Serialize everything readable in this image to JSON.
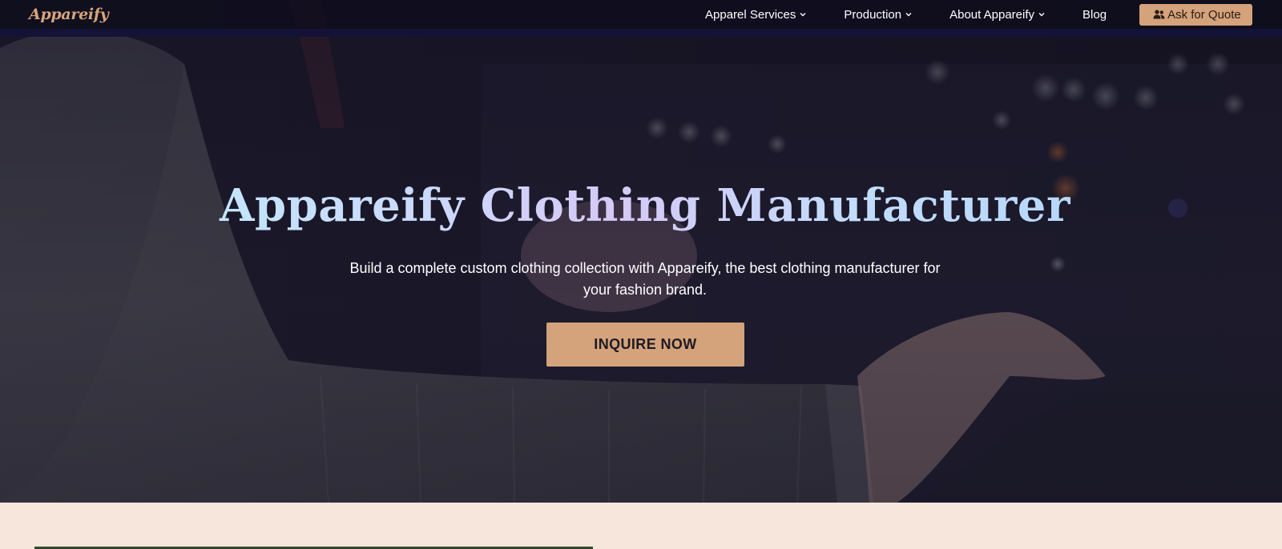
{
  "brand": {
    "logo_text": "Appareify",
    "accent_color": "#d4a27b"
  },
  "nav": {
    "items": [
      {
        "label": "Apparel Services",
        "has_dropdown": true,
        "icon": "chevron-down-icon"
      },
      {
        "label": "Production",
        "has_dropdown": true,
        "icon": "chevron-down-icon"
      },
      {
        "label": "About Appareify",
        "has_dropdown": true,
        "icon": "chevron-down-icon"
      },
      {
        "label": "Blog",
        "has_dropdown": false
      }
    ],
    "cta": {
      "label": "Ask for Quote",
      "icon": "users-icon"
    }
  },
  "hero": {
    "title_parts": [
      "Appareify",
      "Clothing",
      "Manufacturer"
    ],
    "subtitle": "Build a complete custom clothing collection with Appareify, the best clothing manufacturer for your fashion brand.",
    "button_label": "INQUIRE NOW",
    "background_image": "person-in-grey-sweater-at-mixing-console"
  }
}
